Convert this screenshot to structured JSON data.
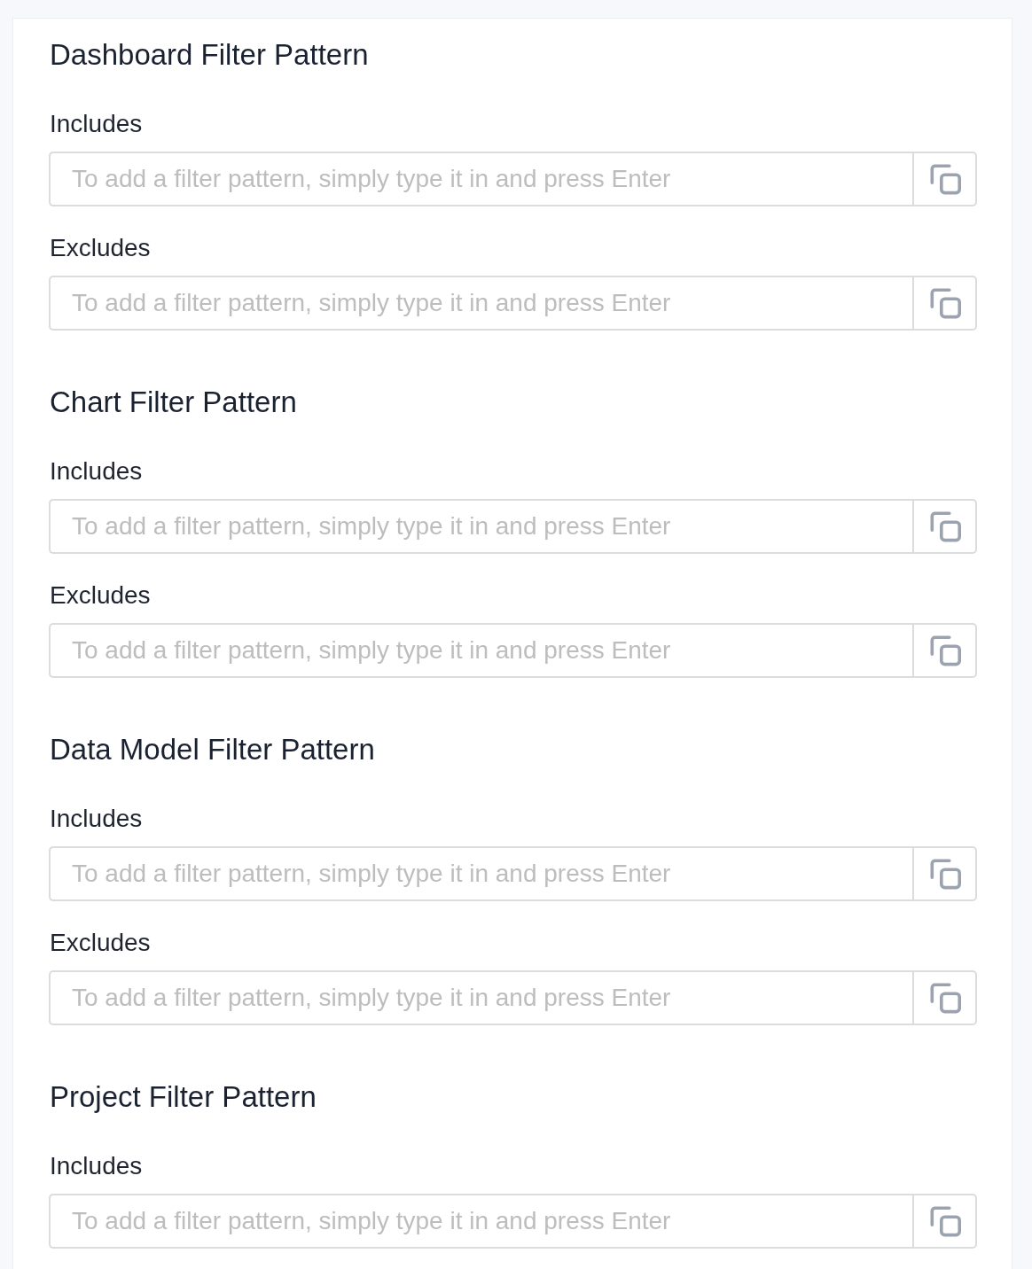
{
  "sections": [
    {
      "title": "Dashboard Filter Pattern",
      "fields": [
        {
          "label": "Includes",
          "placeholder": "To add a filter pattern, simply type it in and press Enter"
        },
        {
          "label": "Excludes",
          "placeholder": "To add a filter pattern, simply type it in and press Enter"
        }
      ]
    },
    {
      "title": "Chart Filter Pattern",
      "fields": [
        {
          "label": "Includes",
          "placeholder": "To add a filter pattern, simply type it in and press Enter"
        },
        {
          "label": "Excludes",
          "placeholder": "To add a filter pattern, simply type it in and press Enter"
        }
      ]
    },
    {
      "title": "Data Model Filter Pattern",
      "fields": [
        {
          "label": "Includes",
          "placeholder": "To add a filter pattern, simply type it in and press Enter"
        },
        {
          "label": "Excludes",
          "placeholder": "To add a filter pattern, simply type it in and press Enter"
        }
      ]
    },
    {
      "title": "Project Filter Pattern",
      "fields": [
        {
          "label": "Includes",
          "placeholder": "To add a filter pattern, simply type it in and press Enter"
        }
      ]
    }
  ]
}
